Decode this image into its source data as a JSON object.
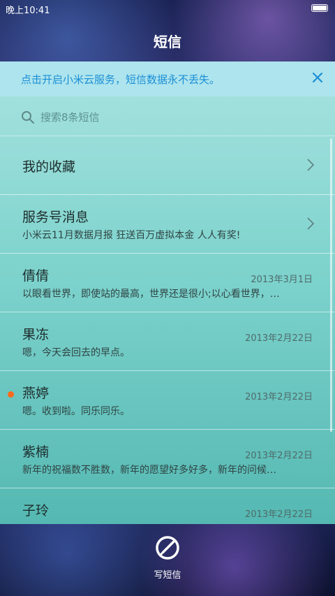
{
  "status": {
    "time": "晚上10:41"
  },
  "app": {
    "title": "短信"
  },
  "banner": {
    "text": "点击开启小米云服务，短信数据永不丢失。"
  },
  "search": {
    "placeholder": "搜索8条短信"
  },
  "rows": [
    {
      "title": "我的收藏"
    },
    {
      "title": "服务号消息",
      "subtitle": "小米云11月数据月报 狂送百万虚拟本金 人人有奖!"
    },
    {
      "title": "倩倩",
      "date": "2013年3月1日",
      "preview": "以眼看世界，即使站的最高，世界还是很小;以心看世界，…"
    },
    {
      "title": "果冻",
      "date": "2013年2月22日",
      "preview": "嗯，今天会回去的早点。"
    },
    {
      "title": "燕婷",
      "date": "2013年2月22日",
      "preview": "嗯。收到啦。同乐同乐。",
      "unread": true
    },
    {
      "title": "紫楠",
      "date": "2013年2月22日",
      "preview": "新年的祝福数不胜数，新年的愿望好多好多，新年的问候…"
    },
    {
      "title": "子玲",
      "date": "2013年2月22日",
      "preview": ""
    }
  ],
  "compose": {
    "label": "写短信"
  },
  "colors": {
    "accent": "#1b8fd6",
    "unread": "#ff6a1a"
  }
}
